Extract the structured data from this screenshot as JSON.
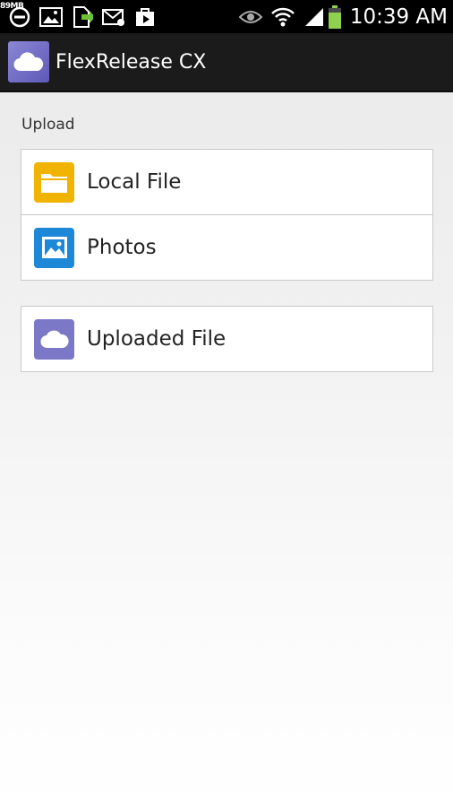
{
  "status_bar": {
    "memory": "89MB",
    "time": "10:39 AM"
  },
  "action_bar": {
    "app_title": "FlexRelease CX",
    "app_icon": "cloud-icon"
  },
  "upload": {
    "section_label": "Upload",
    "items": [
      {
        "label": "Local File",
        "icon": "folder-icon",
        "color": "#f0b400"
      },
      {
        "label": "Photos",
        "icon": "image-icon",
        "color": "#1e88d8"
      }
    ]
  },
  "uploaded": {
    "items": [
      {
        "label": "Uploaded File",
        "icon": "cloud-icon",
        "color": "#7b79c7"
      }
    ]
  }
}
